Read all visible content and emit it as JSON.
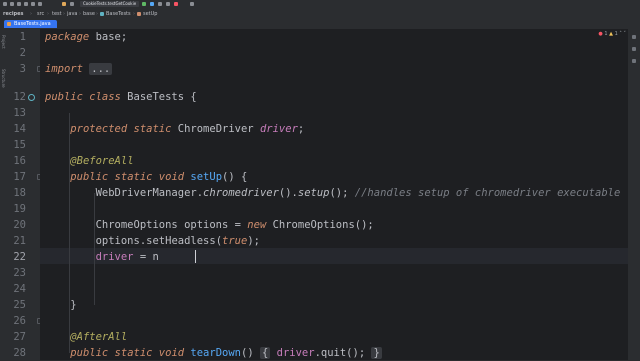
{
  "toolbar": {
    "run_config": "CookieTests.testGetCookie",
    "colors": {
      "run": "#5fb865",
      "debug": "#56a8f5",
      "stop": "#f75464"
    }
  },
  "breadcrumb": {
    "items": [
      "recipes",
      "src",
      "test",
      "java",
      "base",
      "BaseTests",
      "setUp"
    ]
  },
  "tabs": [
    {
      "label": "BaseTests.java",
      "active": true
    }
  ],
  "inspections": {
    "errors": "1",
    "warnings": "1"
  },
  "left_strip": {
    "labels": [
      "Project",
      "Structure"
    ]
  },
  "gutter": {
    "line_numbers": [
      "1",
      "2",
      "3",
      "12",
      "13",
      "14",
      "15",
      "16",
      "17",
      "18",
      "19",
      "20",
      "21",
      "22",
      "23",
      "24",
      "25",
      "26",
      "27",
      "28"
    ],
    "current_line": "22"
  },
  "code": {
    "l1": {
      "kw": "package",
      "rest": " base;"
    },
    "l3": {
      "kw": "import",
      "fold": "..."
    },
    "l12": {
      "kw": "public class",
      "rest": " BaseTests {"
    },
    "l14": {
      "kw": "protected static",
      "type": " ChromeDriver ",
      "field": "driver",
      "end": ";"
    },
    "l16": {
      "ann": "@BeforeAll"
    },
    "l17": {
      "kw": "public static void",
      "method": " setUp",
      "rest": "() {"
    },
    "l18": {
      "cls": "WebDriverManager.",
      "call1": "chromedriver",
      "mid": "().",
      "call2": "setup",
      "end": "(); ",
      "comment": "//handles setup of chromedriver executable"
    },
    "l20": {
      "pre": "ChromeOptions options = ",
      "kw": "new",
      "rest": " ChromeOptions();"
    },
    "l21": {
      "pre": "options.",
      "call": "setHeadless",
      "open": "(",
      "kw": "true",
      "end": ");"
    },
    "l22": {
      "field": "driver",
      "rest": " = n"
    },
    "l26": {
      "rest": "}"
    },
    "l27": {
      "ann": "@AfterAll"
    },
    "l28": {
      "kw": "public static void",
      "method": " tearDown",
      "rest": "() ",
      "fold_open": "{",
      "field": " driver",
      "call": ".quit",
      "end": "(); ",
      "fold_close": "}"
    }
  }
}
